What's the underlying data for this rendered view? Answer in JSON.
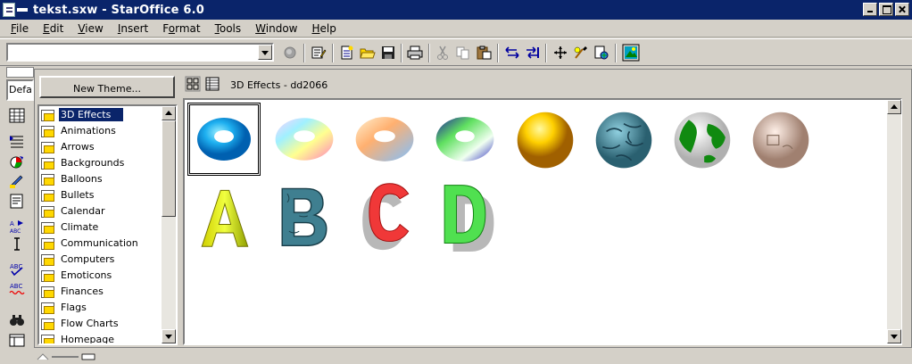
{
  "window": {
    "title": "tekst.sxw - StarOffice 6.0"
  },
  "menu": [
    {
      "label": "File",
      "accel": "F",
      "rest": "ile"
    },
    {
      "label": "Edit",
      "accel": "E",
      "rest": "dit"
    },
    {
      "label": "View",
      "accel": "V",
      "rest": "iew"
    },
    {
      "label": "Insert",
      "accel": "I",
      "rest": "nsert"
    },
    {
      "label": "Format",
      "accel": "o",
      "pre": "F",
      "rest": "rmat"
    },
    {
      "label": "Tools",
      "accel": "T",
      "rest": "ools"
    },
    {
      "label": "Window",
      "accel": "W",
      "rest": "indow"
    },
    {
      "label": "Help",
      "accel": "H",
      "rest": "elp"
    }
  ],
  "toolbar": {
    "url_value": ""
  },
  "style_box": {
    "value": "Defa"
  },
  "gallery": {
    "new_theme_label": "New Theme...",
    "current_theme_title": "3D Effects - dd2066",
    "themes": [
      "3D Effects",
      "Animations",
      "Arrows",
      "Backgrounds",
      "Balloons",
      "Bullets",
      "Calendar",
      "Climate",
      "Communication",
      "Computers",
      "Emoticons",
      "Finances",
      "Flags",
      "Flow Charts",
      "Homepage"
    ],
    "selected_theme_index": 0
  },
  "colors": {
    "titlebar": "#0a246a",
    "selection": "#0a246a",
    "face": "#d4d0c8"
  }
}
